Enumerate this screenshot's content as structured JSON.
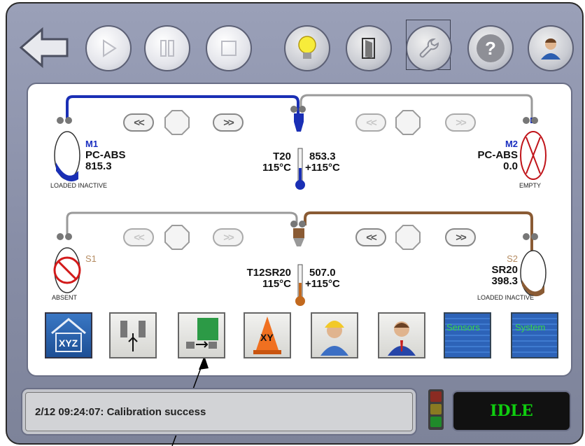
{
  "status": {
    "message": "2/12 09:24:07: Calibration success",
    "state": "IDLE"
  },
  "materials": {
    "m1": {
      "name": "M1",
      "material": "PC-ABS",
      "value": "815.3",
      "state": "LOADED INACTIVE"
    },
    "m2": {
      "name": "M2",
      "material": "PC-ABS",
      "value": "0.0",
      "state": "EMPTY"
    },
    "s1": {
      "name": "S1",
      "state": "ABSENT"
    },
    "s2": {
      "name": "S2",
      "material": "SR20",
      "value": "398.3",
      "state": "LOADED INACTIVE"
    }
  },
  "heads": {
    "top": {
      "name": "T20",
      "value": "853.3",
      "temp_left": "115°C",
      "temp_right": "115°C"
    },
    "bottom": {
      "name": "T12SR20",
      "value": "507.0",
      "temp_left": "115°C",
      "temp_right": "115°C"
    }
  },
  "function_buttons": {
    "home": "XYZ",
    "xy": "XY",
    "sensors": "Sensors",
    "system": "System"
  },
  "colors": {
    "model_line": "#1a2fb5",
    "support_line": "#8a5b34",
    "idle_text": "#0fcd0f"
  },
  "icons": [
    "back-arrow-icon",
    "play-icon",
    "pause-icon",
    "stop-icon",
    "light-bulb-icon",
    "door-icon",
    "wrench-icon",
    "help-icon",
    "user-icon"
  ]
}
